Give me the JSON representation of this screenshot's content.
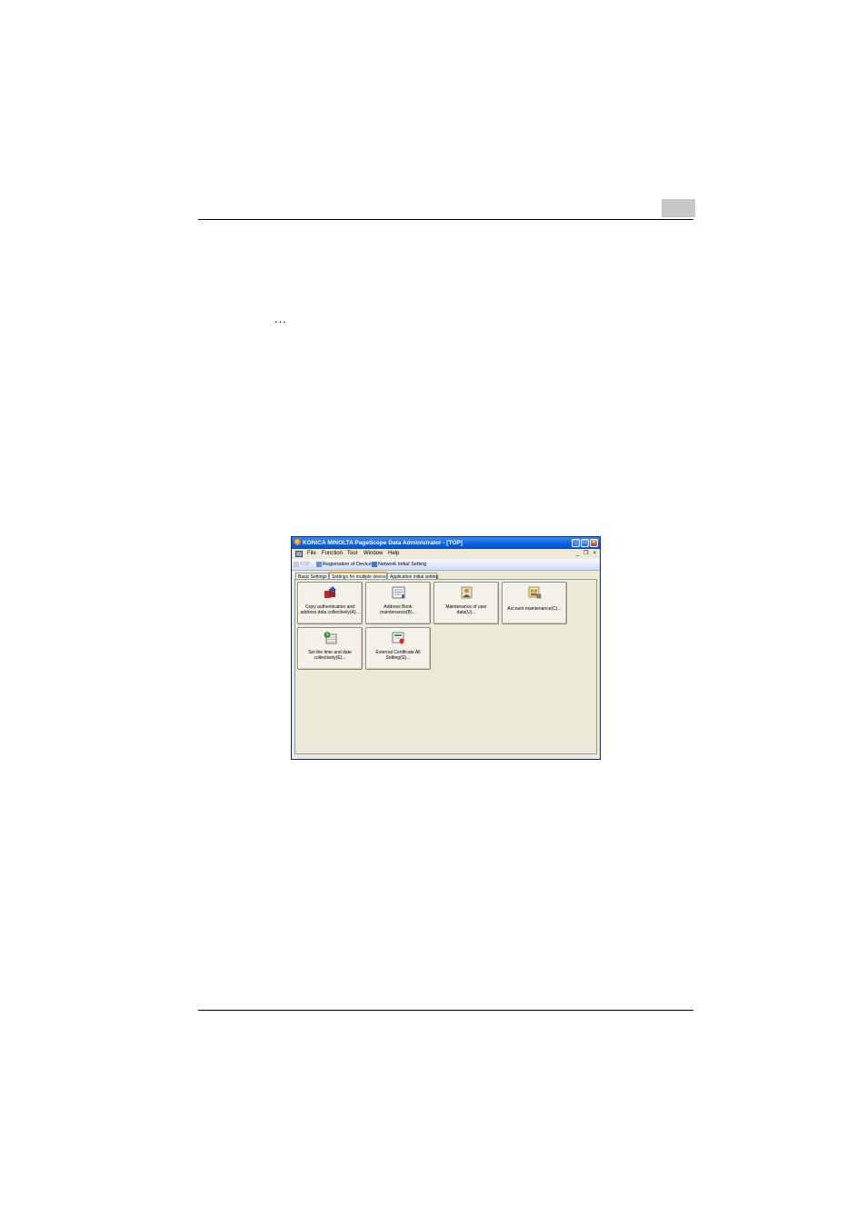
{
  "window": {
    "title": "KONICA MINOLTA PageScope Data Administrator - [TOP]",
    "controls": {
      "minimize": "_",
      "maximize": "□",
      "close": "×"
    }
  },
  "menubar": {
    "items": [
      "File",
      "Function",
      "Tool",
      "Window",
      "Help"
    ],
    "mdi": {
      "minimize": "_",
      "restore": "❐",
      "close": "×"
    }
  },
  "toolbar": {
    "items": [
      "TOP",
      "Registration of Device",
      "Network Initial Setting"
    ]
  },
  "tabs": {
    "items": [
      "Basic Settings",
      "Settings for multiple device",
      "Application initial setting"
    ],
    "active_index": 1
  },
  "tiles": [
    {
      "label": "Copy authentication and address data collectively(A)..."
    },
    {
      "label": "Address Book maintenance(B)..."
    },
    {
      "label": "Maintenance of user data(U)..."
    },
    {
      "label": "Account maintenance(C)..."
    },
    {
      "label": "Set the time and date collectively(E)..."
    },
    {
      "label": "External Certificate All Setting(G)..."
    }
  ],
  "decor": {
    "ellipsis": "..."
  },
  "colors": {
    "titlebar": "#0a5fd8",
    "background": "#ece9d8",
    "active_tab_accent": "#e8a33d"
  }
}
